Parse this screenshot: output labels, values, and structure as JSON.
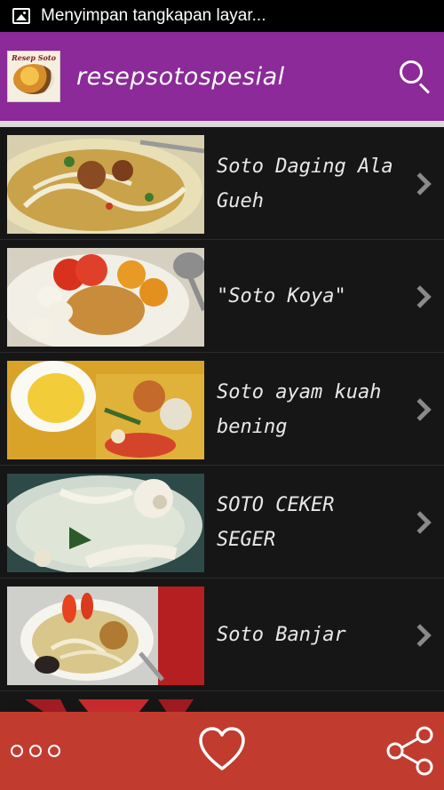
{
  "status_bar": {
    "notification": "Menyimpan tangkapan layar..."
  },
  "app_bar": {
    "logo_text": "Resep Soto",
    "title": "resepsotospesial",
    "color": "#8b2a98"
  },
  "recipes": [
    {
      "title": "Soto Daging Ala Gueh"
    },
    {
      "title": "\"Soto Koya\""
    },
    {
      "title": "Soto ayam kuah bening"
    },
    {
      "title": "SOTO CEKER SEGER"
    },
    {
      "title": "Soto Banjar"
    }
  ],
  "bottom_bar": {
    "color": "#c23b2f",
    "icons": [
      "more-icon",
      "heart-icon",
      "share-icon"
    ]
  }
}
